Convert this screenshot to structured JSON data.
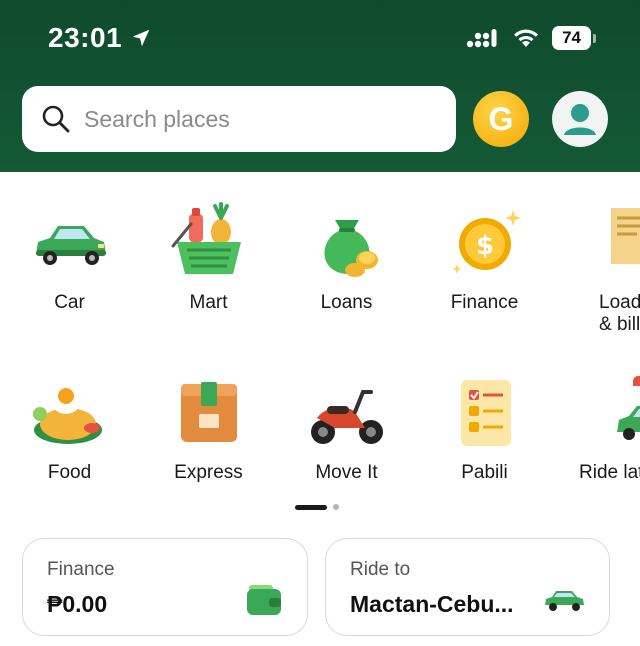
{
  "status_bar": {
    "time": "23:01",
    "battery": "74"
  },
  "search": {
    "placeholder": "Search places"
  },
  "header": {
    "badge_letter": "G"
  },
  "services": [
    {
      "label": "Car",
      "icon": "car-icon"
    },
    {
      "label": "Mart",
      "icon": "grocery-basket-icon"
    },
    {
      "label": "Loans",
      "icon": "money-bag-icon"
    },
    {
      "label": "Finance",
      "icon": "peso-coin-icon"
    },
    {
      "label": "Loads\n& bills",
      "icon": "bill-receipt-icon"
    },
    {
      "label": "Food",
      "icon": "food-plate-icon"
    },
    {
      "label": "Express",
      "icon": "parcel-box-icon"
    },
    {
      "label": "Move It",
      "icon": "motorbike-icon"
    },
    {
      "label": "Pabili",
      "icon": "checklist-icon"
    },
    {
      "label": "Ride later",
      "icon": "scheduled-car-icon"
    }
  ],
  "cards": {
    "finance": {
      "title": "Finance",
      "value": "₱0.00",
      "icon": "wallet-icon"
    },
    "ride": {
      "title": "Ride to",
      "value": "Mactan-Cebu...",
      "icon": "car-icon"
    }
  },
  "colors": {
    "header_green": "#145a37",
    "brand_green": "#3aa856",
    "badge_gold": "#f2a900"
  }
}
